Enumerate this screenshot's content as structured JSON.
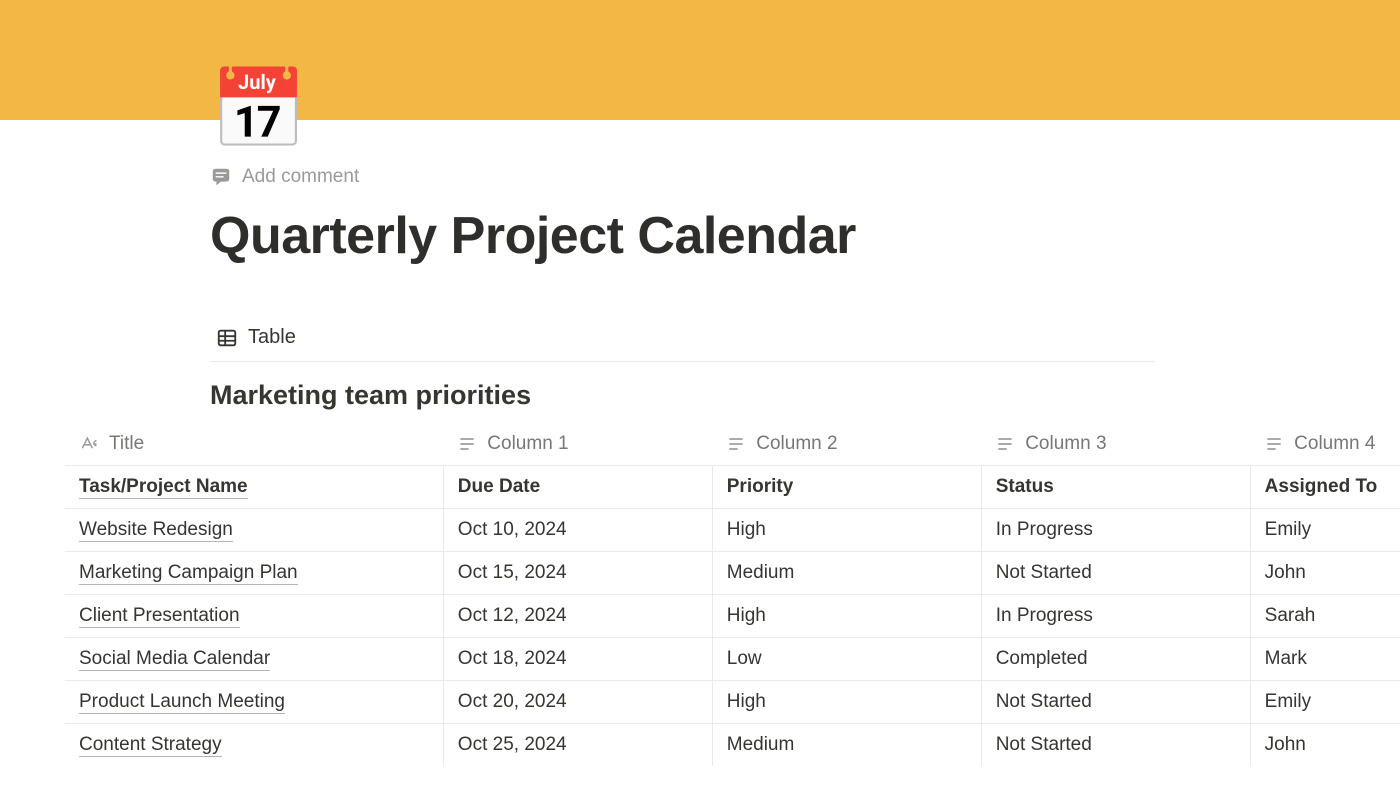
{
  "cover_color": "#f2b744",
  "page": {
    "icon_emoji": "📅",
    "add_comment_label": "Add comment",
    "title": "Quarterly Project Calendar"
  },
  "views": {
    "active_view_label": "Table"
  },
  "database": {
    "title": "Marketing team priorities",
    "columns": [
      {
        "name": "Title",
        "type": "title"
      },
      {
        "name": "Column 1",
        "type": "text"
      },
      {
        "name": "Column 2",
        "type": "text"
      },
      {
        "name": "Column 3",
        "type": "text"
      },
      {
        "name": "Column 4",
        "type": "text"
      }
    ],
    "rows": [
      {
        "title": "Task/Project Name",
        "c1": "Due Date",
        "c2": "Priority",
        "c3": "Status",
        "c4": "Assigned To",
        "is_header": true
      },
      {
        "title": "Website Redesign",
        "c1": "Oct 10, 2024",
        "c2": "High",
        "c3": "In Progress",
        "c4": "Emily"
      },
      {
        "title": "Marketing Campaign Plan",
        "c1": "Oct 15, 2024",
        "c2": "Medium",
        "c3": "Not Started",
        "c4": "John"
      },
      {
        "title": "Client Presentation",
        "c1": "Oct 12, 2024",
        "c2": "High",
        "c3": "In Progress",
        "c4": "Sarah"
      },
      {
        "title": "Social Media Calendar",
        "c1": "Oct 18, 2024",
        "c2": "Low",
        "c3": "Completed",
        "c4": "Mark"
      },
      {
        "title": "Product Launch Meeting",
        "c1": "Oct 20, 2024",
        "c2": "High",
        "c3": "Not Started",
        "c4": "Emily"
      },
      {
        "title": "Content Strategy",
        "c1": "Oct 25, 2024",
        "c2": "Medium",
        "c3": "Not Started",
        "c4": "John"
      }
    ]
  }
}
